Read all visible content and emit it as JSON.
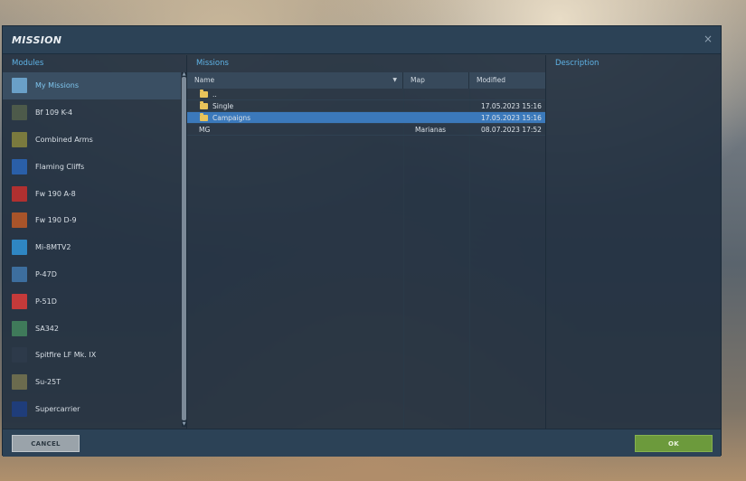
{
  "window": {
    "title": "MISSION",
    "close_glyph": "×"
  },
  "headers": {
    "modules": "Modules",
    "missions": "Missions",
    "description": "Description"
  },
  "modules": [
    {
      "label": "My Missions",
      "icon": "my-missions-icon",
      "color": "#6aa0c8",
      "selected": true
    },
    {
      "label": "Bf 109 K-4",
      "icon": "bf109-icon",
      "color": "#4d5a4a"
    },
    {
      "label": "Combined Arms",
      "icon": "combined-arms-icon",
      "color": "#7a7a3e"
    },
    {
      "label": "Flaming Cliffs",
      "icon": "flaming-cliffs-icon",
      "color": "#2a5fa8"
    },
    {
      "label": "Fw 190 A-8",
      "icon": "fw190a8-icon",
      "color": "#b03030"
    },
    {
      "label": "Fw 190 D-9",
      "icon": "fw190d9-icon",
      "color": "#a8542a"
    },
    {
      "label": "Mi-8MTV2",
      "icon": "mi8-icon",
      "color": "#2f86c2"
    },
    {
      "label": "P-47D",
      "icon": "p47d-icon",
      "color": "#3d6e9e"
    },
    {
      "label": "P-51D",
      "icon": "p51d-icon",
      "color": "#c43a3a"
    },
    {
      "label": "SA342",
      "icon": "sa342-icon",
      "color": "#3f7a5a"
    },
    {
      "label": "Spitfire LF Mk. IX",
      "icon": "spitfire-icon",
      "color": "#2d3a4a"
    },
    {
      "label": "Su-25T",
      "icon": "su25t-icon",
      "color": "#6b6b4e"
    },
    {
      "label": "Supercarrier",
      "icon": "supercarrier-icon",
      "color": "#1f3d7a"
    }
  ],
  "columns": {
    "name": "Name",
    "map": "Map",
    "modified": "Modified"
  },
  "rows": [
    {
      "name": "..",
      "map": "",
      "modified": "",
      "folder": true,
      "selected": false
    },
    {
      "name": "Single",
      "map": "",
      "modified": "17.05.2023 15:16",
      "folder": true,
      "selected": false
    },
    {
      "name": "Campaigns",
      "map": "",
      "modified": "17.05.2023 15:16",
      "folder": true,
      "selected": true
    },
    {
      "name": "MG",
      "map": "Marianas",
      "modified": "08.07.2023 17:52",
      "folder": false,
      "selected": false
    }
  ],
  "buttons": {
    "cancel": "CANCEL",
    "ok": "OK"
  },
  "colors": {
    "accent": "#5fb3e6",
    "selection": "#3b79bb",
    "ok": "#6c9a3c"
  }
}
